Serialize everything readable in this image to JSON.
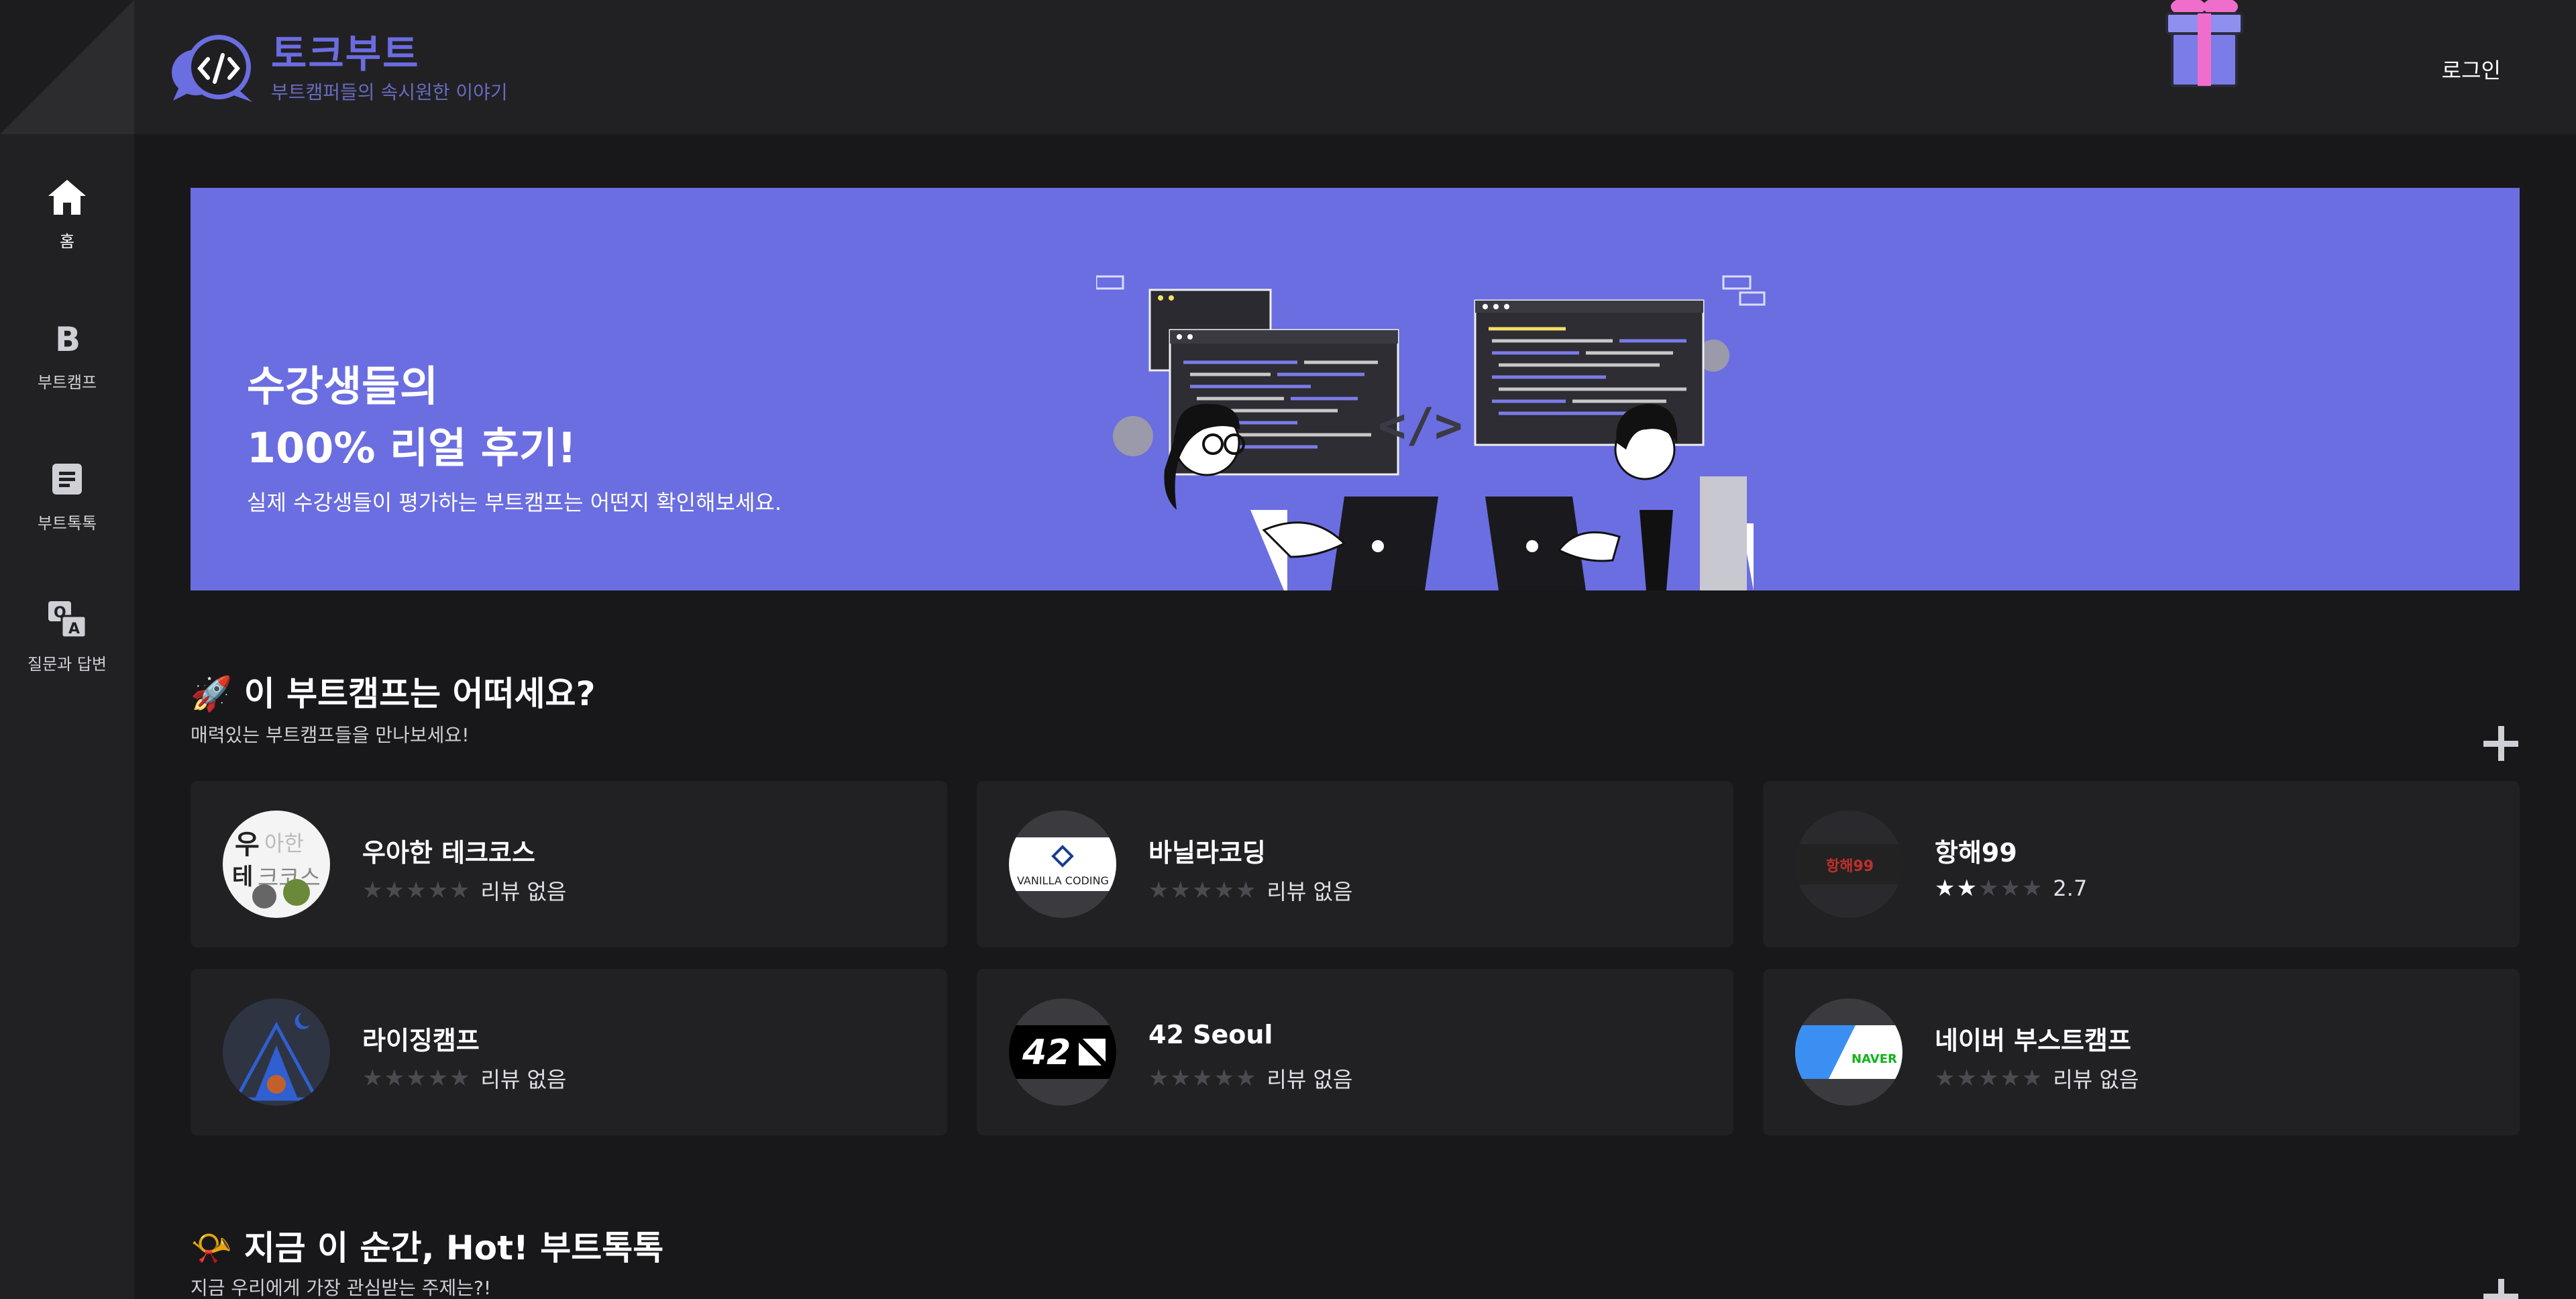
{
  "header": {
    "logo_title": "토크부트",
    "logo_subtitle": "부트캠퍼들의 속시원한 이야기",
    "login_label": "로그인"
  },
  "sidebar": {
    "items": [
      {
        "label": "홈",
        "icon": "home-icon"
      },
      {
        "label": "부트캠프",
        "icon": "b-icon"
      },
      {
        "label": "부트톡톡",
        "icon": "document-icon"
      },
      {
        "label": "질문과 답변",
        "icon": "qa-icon"
      }
    ]
  },
  "banner": {
    "line1": "수강생들의",
    "line2": "100% 리얼 후기!",
    "subtitle": "실제 수강생들이 평가하는 부트캠프는 어떤지 확인해보세요."
  },
  "section1": {
    "emoji": "🚀",
    "title": "이 부트캠프는 어떠세요?",
    "subtitle": "매력있는 부트캠프들을 만나보세요!"
  },
  "bootcamps": [
    {
      "name": "우아한 테크코스",
      "stars": 0,
      "rating_text": "리뷰 없음",
      "thumb_text": "우아한 테크코스"
    },
    {
      "name": "바닐라코딩",
      "stars": 0,
      "rating_text": "리뷰 없음",
      "thumb_text": "VANILLA CODING"
    },
    {
      "name": "항해99",
      "stars": 2,
      "rating_text": "2.7",
      "thumb_text": "항해99"
    },
    {
      "name": "라이징캠프",
      "stars": 0,
      "rating_text": "리뷰 없음",
      "thumb_text": ""
    },
    {
      "name": "42 Seoul",
      "stars": 0,
      "rating_text": "리뷰 없음",
      "thumb_text": "42 SEOUL"
    },
    {
      "name": "네이버 부스트캠프",
      "stars": 0,
      "rating_text": "리뷰 없음",
      "thumb_text": "NAVER"
    }
  ],
  "section2": {
    "emoji": "📯",
    "title": "지금 이 순간, Hot! 부트톡톡",
    "subtitle": "지금 우리에게 가장 관심받는 주제는?!"
  },
  "colors": {
    "accent": "#6b6ee0",
    "background": "#18181b",
    "panel": "#212124"
  }
}
